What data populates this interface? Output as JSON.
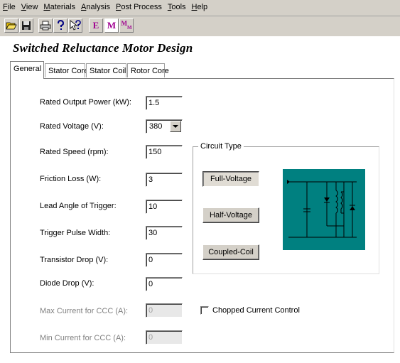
{
  "menu": [
    {
      "first": "F",
      "rest": "ile"
    },
    {
      "first": "V",
      "rest": "iew"
    },
    {
      "first": "M",
      "rest": "aterials"
    },
    {
      "first": "A",
      "rest": "nalysis"
    },
    {
      "first": "P",
      "rest": "ost Process"
    },
    {
      "first": "T",
      "rest": "ools"
    },
    {
      "first": "H",
      "rest": "elp"
    }
  ],
  "toolbar": {
    "icons": [
      "open-folder-icon",
      "save-disk-icon",
      "print-icon",
      "help-icon",
      "context-help-icon"
    ],
    "letter_e": "E",
    "letter_m": "M",
    "letter_m_sub": "M",
    "letter_m_sub_small": "M"
  },
  "title": "Switched Reluctance Motor Design",
  "tabs": [
    "General",
    "Stator Core",
    "Stator Coil",
    "Rotor Core"
  ],
  "fields": {
    "rated_output_power": {
      "label": "Rated Output Power (kW):",
      "value": "1.5"
    },
    "rated_voltage": {
      "label": "Rated Voltage (V):",
      "value": "380"
    },
    "rated_speed": {
      "label": "Rated Speed (rpm):",
      "value": "150"
    },
    "friction_loss": {
      "label": "Friction Loss (W):",
      "value": "3"
    },
    "lead_angle": {
      "label": "Lead Angle of Trigger:",
      "value": "10"
    },
    "trigger_pulse_width": {
      "label": "Trigger Pulse Width:",
      "value": "30"
    },
    "transistor_drop": {
      "label": "Transistor Drop (V):",
      "value": "0"
    },
    "diode_drop": {
      "label": "Diode Drop (V):",
      "value": "0"
    },
    "max_current_ccc": {
      "label": "Max Current for CCC (A):",
      "value": "0"
    },
    "min_current_ccc": {
      "label": "Min Current for CCC (A):",
      "value": "0"
    }
  },
  "circuit_type": {
    "label": "Circuit Type",
    "buttons": [
      "Full-Voltage",
      "Half-Voltage",
      "Coupled-Coil"
    ],
    "selected": "Full-Voltage"
  },
  "chopped_current_control": {
    "label": "Chopped Current Control",
    "checked": false
  },
  "colors": {
    "diagram_bg": "#008080",
    "toolbar_letter": "#a00090"
  }
}
